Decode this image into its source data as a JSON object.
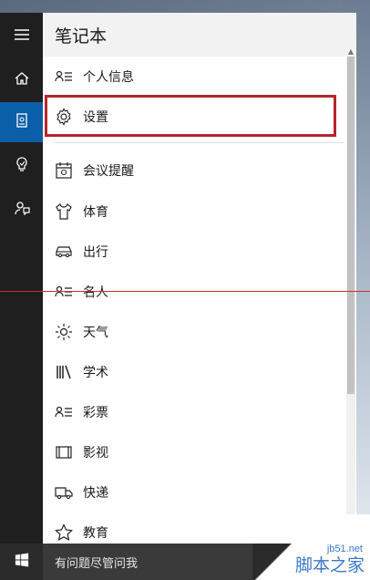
{
  "panel": {
    "title": "笔记本"
  },
  "menu": {
    "items": [
      {
        "label": "个人信息",
        "icon": "person-list-icon"
      },
      {
        "label": "设置",
        "icon": "gear-icon"
      },
      {
        "label": "会议提醒",
        "icon": "calendar-icon"
      },
      {
        "label": "体育",
        "icon": "jersey-icon"
      },
      {
        "label": "出行",
        "icon": "car-icon"
      },
      {
        "label": "名人",
        "icon": "person-list-icon"
      },
      {
        "label": "天气",
        "icon": "sun-icon"
      },
      {
        "label": "学术",
        "icon": "books-icon"
      },
      {
        "label": "彩票",
        "icon": "person-list-icon"
      },
      {
        "label": "影视",
        "icon": "film-icon"
      },
      {
        "label": "快递",
        "icon": "truck-icon"
      },
      {
        "label": "教育",
        "icon": "star-icon"
      }
    ]
  },
  "rail": {
    "items": [
      {
        "icon": "hamburger-menu-icon"
      },
      {
        "icon": "home-icon"
      },
      {
        "icon": "notebook-icon",
        "active": true
      },
      {
        "icon": "lightbulb-icon"
      },
      {
        "icon": "feedback-icon"
      }
    ]
  },
  "taskbar": {
    "search_placeholder": "有问题尽管问我"
  },
  "watermark": {
    "url": "jb51.net",
    "name": "脚本之家"
  },
  "colors": {
    "accent": "#0b5ea8",
    "highlight": "#b5252a",
    "guide": "#d22b2b"
  }
}
